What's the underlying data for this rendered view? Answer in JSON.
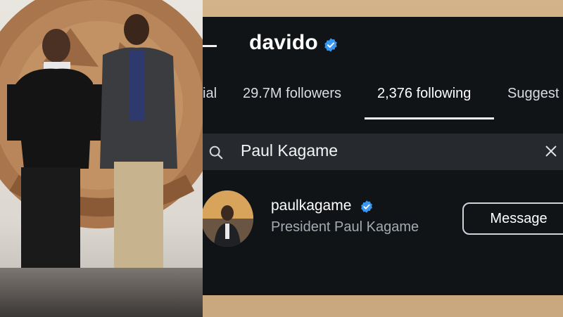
{
  "profile": {
    "username": "davido",
    "verified": true
  },
  "tabs": [
    {
      "label": "ial"
    },
    {
      "label": "29.7M followers"
    },
    {
      "label": "2,376 following",
      "active": true
    },
    {
      "label": "Suggest"
    }
  ],
  "search": {
    "query": "Paul Kagame"
  },
  "result": {
    "username": "paulkagame",
    "verified": true,
    "full_name": "President Paul Kagame",
    "button_label": "Message"
  },
  "colors": {
    "screen_bg": "#111417",
    "search_bg": "#262a2f",
    "verified_blue": "#3897f0"
  }
}
